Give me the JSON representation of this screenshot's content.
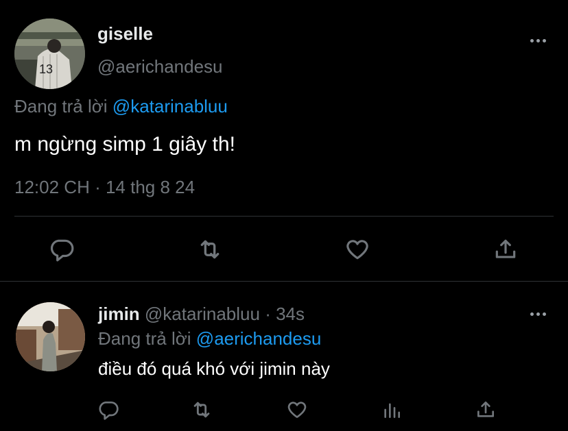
{
  "main_tweet": {
    "display_name": "giselle",
    "handle": "@aerichandesu",
    "replying_label": "Đang trả lời",
    "replying_to": "@katarinabluu",
    "text": "m ngừng simp 1 giây th!",
    "timestamp": "12:02 CH · 14 thg 8 24",
    "actions": [
      "reply-icon",
      "retweet-icon",
      "like-icon",
      "share-icon"
    ]
  },
  "reply_tweet": {
    "display_name": "jimin",
    "handle": "@katarinabluu",
    "time_ago": "· 34s",
    "replying_label": "Đang trả lời",
    "replying_to": "@aerichandesu",
    "text": "điều đó quá khó với jimin này",
    "actions": [
      "reply-icon",
      "retweet-icon",
      "like-icon",
      "analytics-icon",
      "share-icon"
    ]
  },
  "colors": {
    "background": "#000000",
    "text": "#e7e9ea",
    "muted": "#71767b",
    "link": "#1d9bf0",
    "divider": "#2f3336"
  }
}
